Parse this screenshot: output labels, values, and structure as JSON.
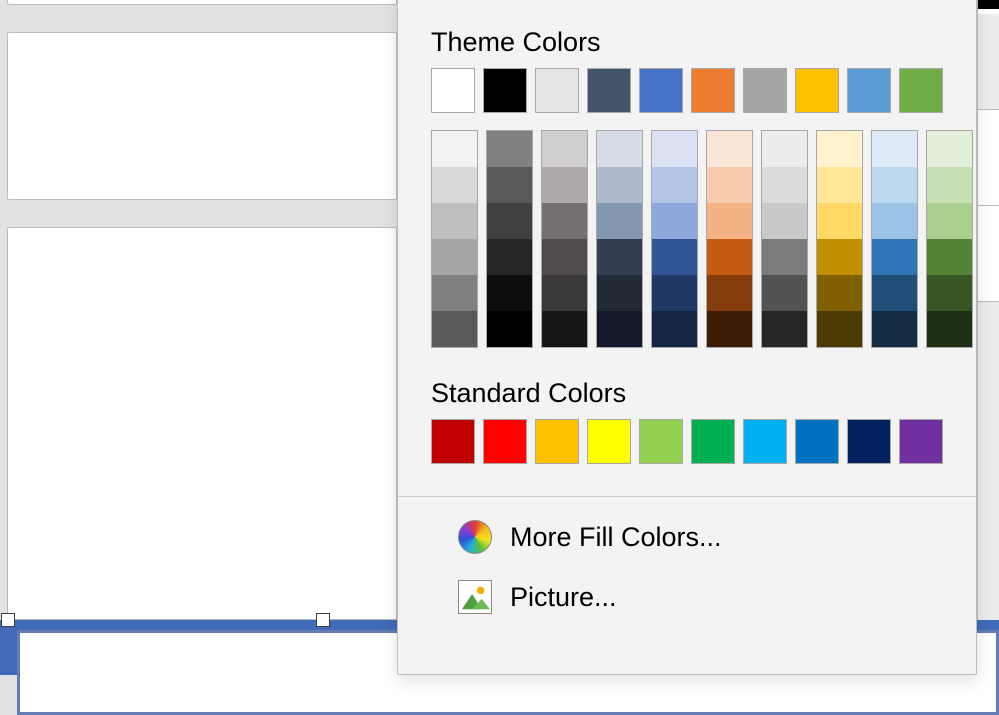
{
  "sections": {
    "theme_title": "Theme Colors",
    "standard_title": "Standard Colors"
  },
  "theme_main": [
    {
      "name": "White",
      "hex": "#ffffff"
    },
    {
      "name": "Black",
      "hex": "#000000"
    },
    {
      "name": "Light Gray",
      "hex": "#e7e6e6"
    },
    {
      "name": "Blue-Gray",
      "hex": "#44546a"
    },
    {
      "name": "Blue",
      "hex": "#4472c4"
    },
    {
      "name": "Orange",
      "hex": "#ed7d31"
    },
    {
      "name": "Gray",
      "hex": "#a5a5a5"
    },
    {
      "name": "Gold",
      "hex": "#ffc000"
    },
    {
      "name": "Light Blue",
      "hex": "#5b9bd5"
    },
    {
      "name": "Green",
      "hex": "#70ad47"
    }
  ],
  "theme_shades": [
    [
      "#f2f2f2",
      "#d9d9d9",
      "#bfbfbf",
      "#a6a6a6",
      "#808080",
      "#595959"
    ],
    [
      "#808080",
      "#595959",
      "#404040",
      "#262626",
      "#0d0d0d",
      "#000000"
    ],
    [
      "#d0cece",
      "#aeaaaa",
      "#767171",
      "#4f4b4b",
      "#3a3838",
      "#161616"
    ],
    [
      "#d6dce5",
      "#adb9ca",
      "#8497b0",
      "#333f50",
      "#222b35",
      "#13192a"
    ],
    [
      "#d9e1f2",
      "#b4c6e7",
      "#8ea9db",
      "#2f5597",
      "#203864",
      "#152544"
    ],
    [
      "#fbe5d6",
      "#f7caac",
      "#f4b183",
      "#c55a11",
      "#843c0c",
      "#3d1c07"
    ],
    [
      "#ededed",
      "#dbdbdb",
      "#c9c9c9",
      "#7b7b7b",
      "#525252",
      "#262626"
    ],
    [
      "#fff2cc",
      "#ffe699",
      "#ffd966",
      "#bf8f00",
      "#806000",
      "#4e3b01"
    ],
    [
      "#deebf7",
      "#bdd7ee",
      "#9cc2e5",
      "#2e75b6",
      "#1f4e79",
      "#142c44"
    ],
    [
      "#e2efda",
      "#c6e0b4",
      "#a9d08e",
      "#548235",
      "#375623",
      "#1e3014"
    ]
  ],
  "standard_colors": [
    {
      "name": "Dark Red",
      "hex": "#c00000"
    },
    {
      "name": "Red",
      "hex": "#ff0000"
    },
    {
      "name": "Orange",
      "hex": "#ffc000"
    },
    {
      "name": "Yellow",
      "hex": "#ffff00"
    },
    {
      "name": "Light Green",
      "hex": "#92d050"
    },
    {
      "name": "Green",
      "hex": "#00b050"
    },
    {
      "name": "Light Blue",
      "hex": "#00b0f0"
    },
    {
      "name": "Blue",
      "hex": "#0070c0"
    },
    {
      "name": "Dark Blue",
      "hex": "#002060"
    },
    {
      "name": "Purple",
      "hex": "#7030a0"
    }
  ],
  "menu": {
    "more_fill": "More Fill Colors...",
    "picture": "Picture..."
  }
}
